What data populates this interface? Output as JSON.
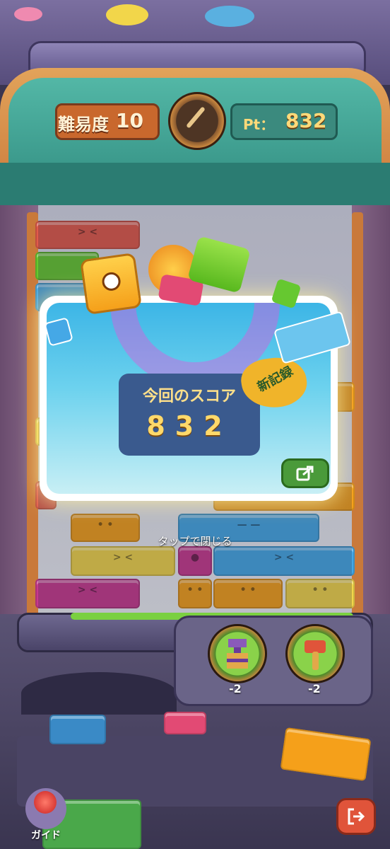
{
  "header": {
    "level_label": "難易度",
    "level_value": "10",
    "pt_label": "Pt：",
    "pt_value": "832"
  },
  "popup": {
    "score_title": "今回のスコア",
    "score_value": "832",
    "new_record_label": "新記録"
  },
  "hint": {
    "tap_to_close": "タップで閉じる"
  },
  "tools": [
    {
      "name": "box-tool",
      "count": "-2"
    },
    {
      "name": "hammer-tool",
      "count": "-2"
    }
  ],
  "footer": {
    "guide_label": "ガイド"
  },
  "colors": {
    "level_box": "#c9682d",
    "pt_box": "#3b8a7e",
    "score_panel": "#3a5a8e",
    "share_button": "#4a9a3a",
    "exit_button": "#e0543a"
  },
  "icons": [
    "speed-gauge-icon",
    "share-icon",
    "box-tool-icon",
    "hammer-tool-icon",
    "joystick-icon",
    "exit-icon"
  ]
}
